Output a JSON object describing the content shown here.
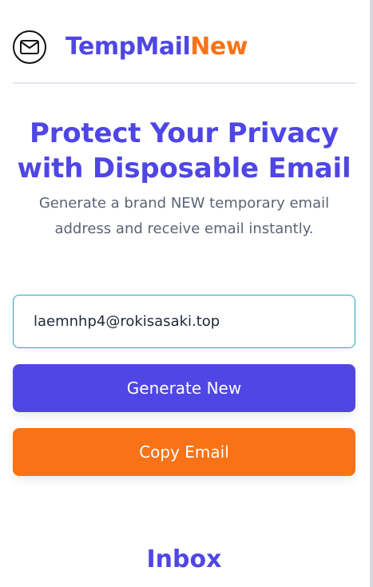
{
  "header": {
    "brand_primary": "TempMail",
    "brand_accent": "New",
    "logo_icon": "mail-icon"
  },
  "hero": {
    "title_line_1": "Protect Your Privacy",
    "title_line_2": "with Disposable Email",
    "subtitle_line_1": "Generate a brand NEW temporary email",
    "subtitle_line_2": "address and receive email instantly."
  },
  "email": {
    "value": "laemnhp4@rokisasaki.top"
  },
  "actions": {
    "generate_label": "Generate New",
    "copy_label": "Copy Email"
  },
  "inbox": {
    "title": "Inbox"
  },
  "colors": {
    "primary": "#4f46e5",
    "accent": "#f97316",
    "input_border": "#18a7c9",
    "subtitle": "#5b6475",
    "divider": "#e6e6f2"
  }
}
